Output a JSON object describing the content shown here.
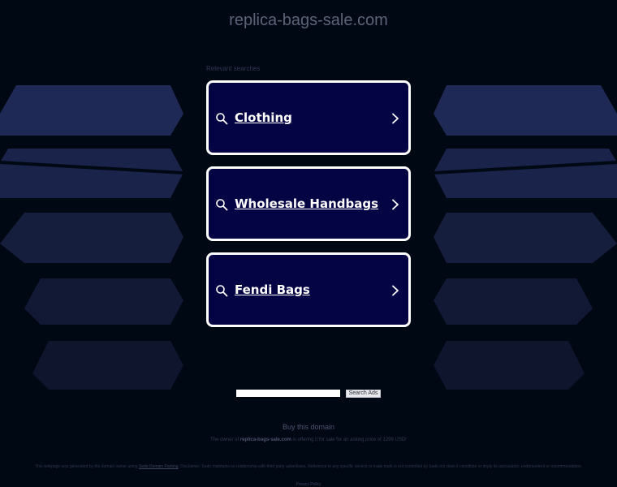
{
  "page": {
    "domain_title": "replica-bags-sale.com",
    "relevant_searches_label": "Relevant searches"
  },
  "cards": [
    {
      "label": "Clothing"
    },
    {
      "label": "Wholesale Handbags"
    },
    {
      "label": "Fendi Bags"
    }
  ],
  "search": {
    "value": "",
    "button_label": "Search Ads"
  },
  "footer": {
    "buy_label": "Buy this domain",
    "owner_prefix": "The owner of",
    "owner_domain": "replica-bags-sale.com",
    "owner_suffix": "is offering it for sale for an asking price of 1299 USD!",
    "disclaimer_prefix": "This webpage was generated by the domain owner using",
    "disclaimer_link": "Sedo Domain Parking",
    "disclaimer_suffix": ". Disclaimer: Sedo maintains no relationship with third party advertisers. Reference to any specific service or trade mark is not controlled by Sedo nor does it constitute or imply its association, endorsement or recommendation.",
    "privacy_label": "Privacy Policy"
  },
  "icons": {
    "search": "magnifier-icon",
    "chevron": "chevron-right-icon"
  },
  "colors": {
    "background": "#000814",
    "card_fill": "#040445",
    "card_border": "#ffffff",
    "shape_fill": "#1c2545"
  }
}
